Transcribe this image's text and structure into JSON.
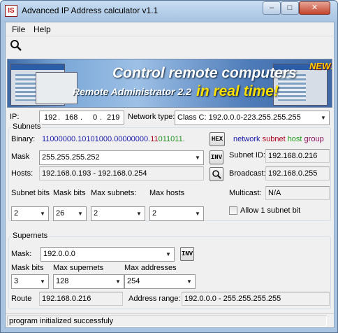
{
  "window": {
    "title": "Advanced IP Address calculator v1.1",
    "icon_text": "IS"
  },
  "titlebar_buttons": {
    "minimize": "–",
    "maximize": "□",
    "close": "✕"
  },
  "menu": [
    "File",
    "Help"
  ],
  "banner": {
    "line1": "Control remote computers",
    "line2a": "Remote Administrator 2.2",
    "line2b": "in real time!",
    "badge": "NEW!"
  },
  "ip": {
    "label": "IP:",
    "octets": [
      "192",
      "168",
      "0",
      "219"
    ],
    "separator": "."
  },
  "network_type": {
    "label": "Network type:",
    "value": "Class C: 192.0.0.0-223.255.255.255"
  },
  "subnets": {
    "title": "Subnets",
    "binary_label": "Binary:",
    "binary": {
      "net": "110",
      "sub": "00000.10101000.00000000.",
      "host_sub": "11",
      "host": "011011."
    },
    "hex_button": "HEX",
    "legend": {
      "network": "network",
      "subnet": "subnet",
      "host": "host",
      "group": "group"
    },
    "mask_label": "Mask",
    "mask_value": "255.255.255.252",
    "inv_button": "INV",
    "subnet_id_label": "Subnet ID:",
    "subnet_id": "192.168.0.216",
    "hosts_label": "Hosts:",
    "hosts": "192.168.0.193 - 192.168.0.254",
    "broadcast_label": "Broadcast:",
    "broadcast": "192.168.0.255",
    "subnet_bits_label": "Subnet bits",
    "subnet_bits": "2",
    "mask_bits_label": "Mask bits",
    "mask_bits": "26",
    "max_subnets_label": "Max subnets:",
    "max_subnets": "2",
    "max_hosts_label": "Max hosts",
    "max_hosts": "2",
    "multicast_label": "Multicast:",
    "multicast": "N/A",
    "allow_label": "Allow 1 subnet bit"
  },
  "supernets": {
    "title": "Supernets",
    "mask_label": "Mask:",
    "mask_value": "192.0.0.0",
    "inv_button": "INV",
    "mask_bits_label": "Mask bits",
    "mask_bits": "3",
    "max_supernets_label": "Max supernets",
    "max_supernets": "128",
    "max_addresses_label": "Max addresses",
    "max_addresses": "254",
    "route_label": "Route",
    "route": "192.168.0.216",
    "address_range_label": "Address range:",
    "address_range": "192.0.0.0 - 255.255.255.255"
  },
  "status": {
    "text": "program initialized successfuly"
  },
  "colors": {
    "network": "#1a1aa8",
    "subnet": "#a8001f",
    "host": "#1f9f1f",
    "group": "#8a0f5a"
  },
  "icons": {
    "search": "magnifier-icon",
    "dropdown": "chevron-down-icon"
  }
}
